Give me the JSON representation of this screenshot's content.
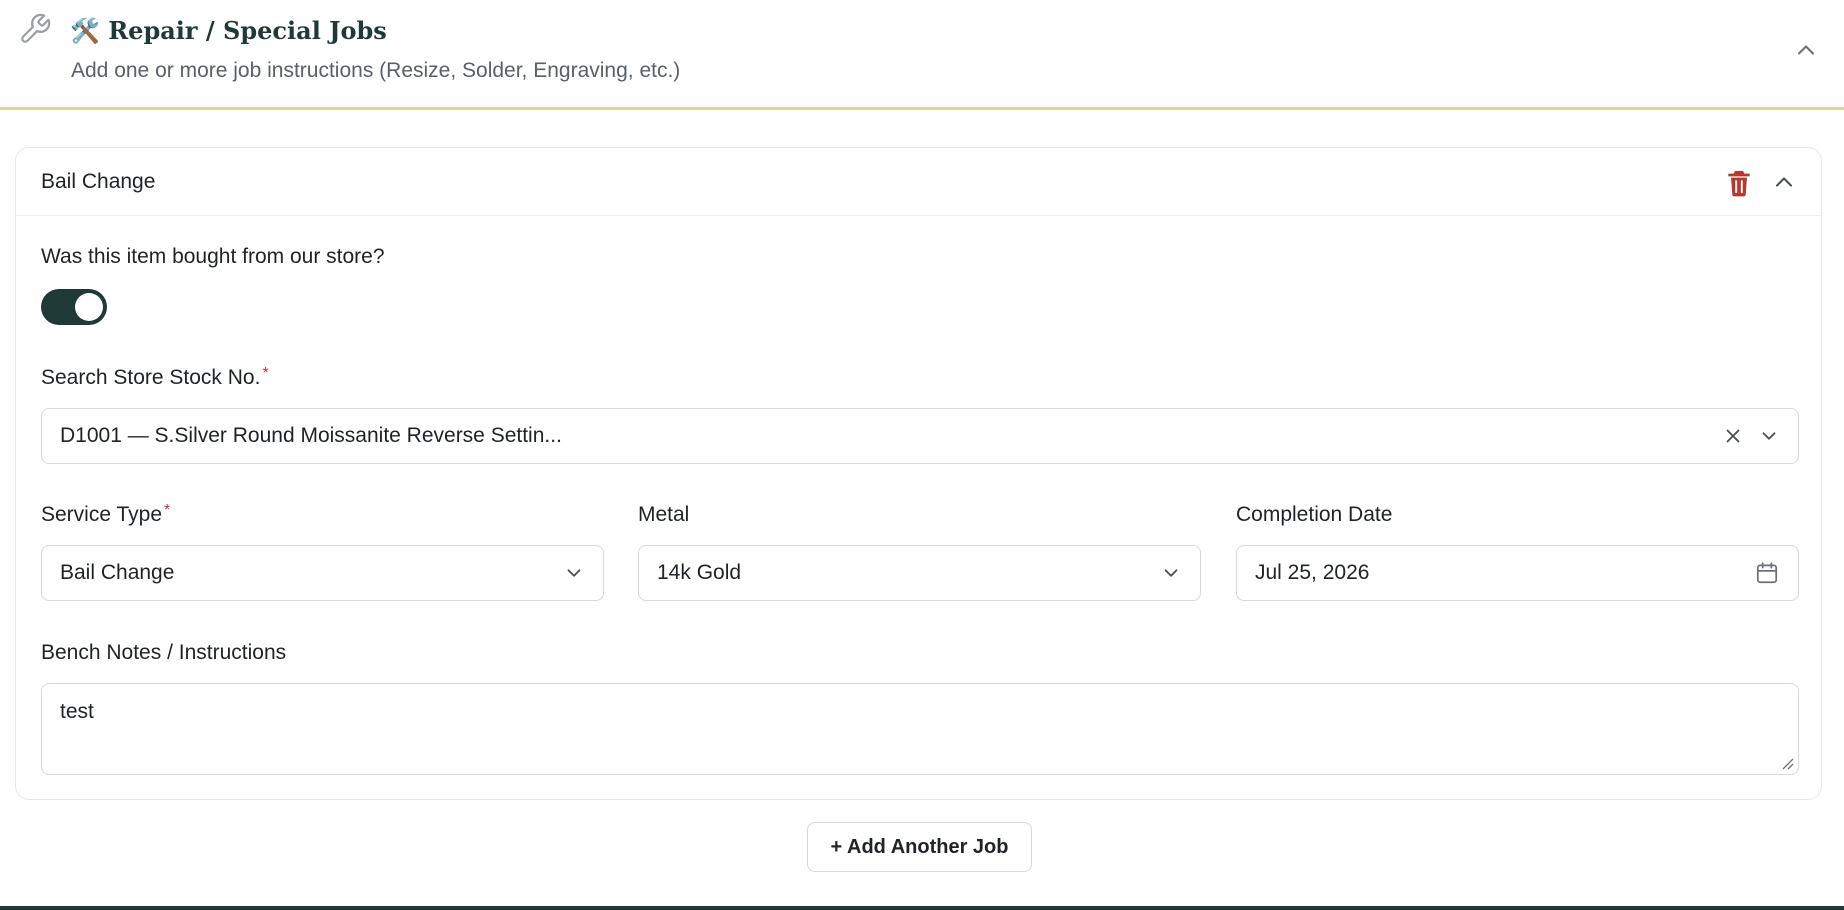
{
  "section": {
    "title": "🛠️ Repair / Special Jobs",
    "subtitle": "Add one or more job instructions (Resize, Solder, Engraving, etc.)",
    "icon": "wrench-icon"
  },
  "job": {
    "title": "Bail Change",
    "bought_question": "Was this item bought from our store?",
    "bought_from_store": true,
    "stock": {
      "label": "Search Store Stock No.",
      "required_mark": "*",
      "value": "D1001 — S.Silver Round Moissanite Reverse Settin..."
    },
    "service_type": {
      "label": "Service Type",
      "required_mark": "*",
      "value": "Bail Change"
    },
    "metal": {
      "label": "Metal",
      "value": "14k Gold"
    },
    "completion_date": {
      "label": "Completion Date",
      "value": "Jul 25, 2026"
    },
    "notes": {
      "label": "Bench Notes / Instructions",
      "value": "test"
    }
  },
  "actions": {
    "add_job_label": "+ Add Another Job"
  },
  "colors": {
    "accent": "#1f3a36",
    "divider_gold": "#e3d3a4",
    "danger": "#b5392f",
    "required": "#c0392b"
  }
}
